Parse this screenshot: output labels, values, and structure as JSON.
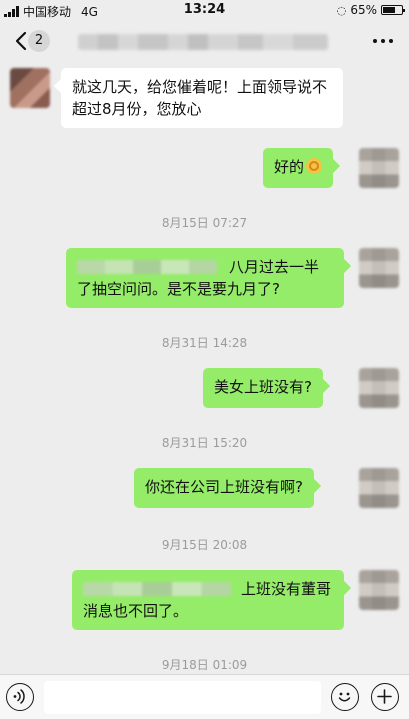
{
  "status_bar": {
    "carrier": "中国移动",
    "network": "4G",
    "time": "13:24",
    "battery": "65%",
    "battery_level": 0.65
  },
  "nav": {
    "back_badge": "2",
    "back_icon": "chevron-left-icon",
    "more_icon": "more-dots-icon"
  },
  "messages": [
    {
      "side": "in",
      "text": "就这几天，给您催着呢！上面领导说不超过8月份，您放心"
    },
    {
      "side": "out",
      "text": "好的"
    },
    {
      "side": "out",
      "text": "八月过去一半了抽空问问。是不是要九月了?"
    },
    {
      "side": "out",
      "text": "美女上班没有?"
    },
    {
      "side": "out",
      "text": "你还在公司上班没有啊?"
    },
    {
      "side": "out",
      "text": "上班没有董哥消息也不回了。"
    }
  ],
  "timestamps": [
    "8月15日 07:27",
    "8月31日 14:28",
    "8月31日 15:20",
    "9月15日 20:08",
    "9月18日 01:09"
  ],
  "input_bar": {
    "value": "",
    "voice_icon": "voice-icon",
    "emoji_icon": "emoji-icon",
    "plus_icon": "plus-icon"
  },
  "colors": {
    "background": "#ededed",
    "outgoing_bubble": "#95ec69",
    "incoming_bubble": "#ffffff",
    "timestamp_text": "#9b9b9b"
  }
}
